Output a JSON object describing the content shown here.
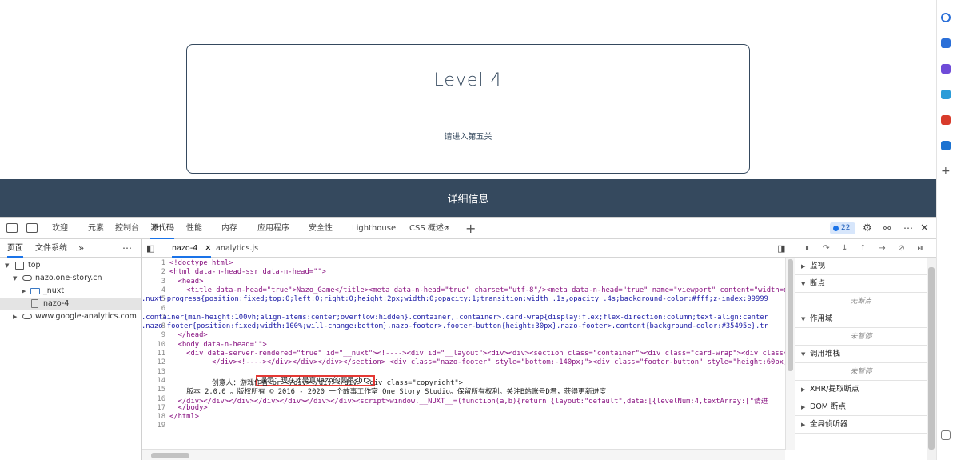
{
  "page": {
    "level_title": "Level 4",
    "level_subtitle": "请进入第五关",
    "footer_label": "详细信息"
  },
  "devtools": {
    "tabs": [
      "欢迎",
      "元素",
      "控制台",
      "源代码",
      "性能",
      "内存",
      "应用程序",
      "安全性",
      "Lighthouse",
      "CSS 概述"
    ],
    "active_tab": "源代码",
    "issues_count": "22",
    "navigator": {
      "tabs": [
        "页面",
        "文件系统"
      ],
      "tree": [
        "top",
        "nazo.one-story.cn",
        "_nuxt",
        "nazo-4",
        "www.google-analytics.com"
      ]
    },
    "editor": {
      "tabs": [
        "nazo-4",
        "analytics.js"
      ],
      "line_numbers": [
        "1",
        "2",
        "3",
        "4",
        "5",
        "6",
        "7",
        "8",
        "9",
        "10",
        "11",
        "12",
        "13",
        "14",
        "15",
        "16",
        "17",
        "18",
        "19"
      ],
      "lines": [
        "<!doctype html>",
        "<html data-n-head-ssr data-n-head=\"\">",
        "  <head>",
        "    <title data-n-head=\"true\">Nazo_Game</title><meta data-n-head=\"true\" charset=\"utf-8\"/><meta data-n-head=\"true\" name=\"viewport\" content=\"width=dev",
        ".nuxt-progress{position:fixed;top:0;left:0;right:0;height:2px;width:0;opacity:1;transition:width .1s,opacity .4s;background-color:#fff;z-index:99999",
        "",
        ".container{min-height:100vh;align-items:center;overflow:hidden}.container,.container>.card-wrap{display:flex;flex-direction:column;text-align:center",
        ".nazo-footer{position:fixed;width:100%;will-change:bottom}.nazo-footer>.footer-button{height:30px}.nazo-footer>.content{background-color:#35495e}.tr",
        "  </head>",
        "  <body data-n-head=\"\">",
        "    <div data-server-rendered=\"true\" id=\"__nuxt\"><!----><div id=\"__layout\"><div><div><section class=\"container\"><div class=\"card-wrap\"><div class=\"c",
        "          </div><!----></div></div></div></section> <div class=\"nazo-footer\" style=\"bottom:-140px;\"><div class=\"footer-button\" style=\"height:60px;\"",
        "提示：现在才是真Nazo的题目<br>",
        "          创意人：游戏作者<br></div></div></div> <div class=\"copyright\">",
        "    版本 2.0.0 。版权所有 © 2016 - 2020 一个故事工作室 One Story Studio。保留所有权利。关注B站账号D君，获得更新进度",
        "  </div></div></div></div></div></div></div><script>window.__NUXT__=(function(a,b){return {layout:\"default\",data:[{levelNum:4,textArray:[\"请进",
        "  </body>",
        "</html>",
        ""
      ]
    },
    "debugger": {
      "sections": [
        "监视",
        "断点",
        "作用域",
        "调用堆栈",
        "XHR/提取断点",
        "DOM 断点",
        "全局侦听器"
      ],
      "no_breakpoints": "无断点",
      "not_paused_scope": "未暂停",
      "not_paused_stack": "未暂停"
    }
  }
}
